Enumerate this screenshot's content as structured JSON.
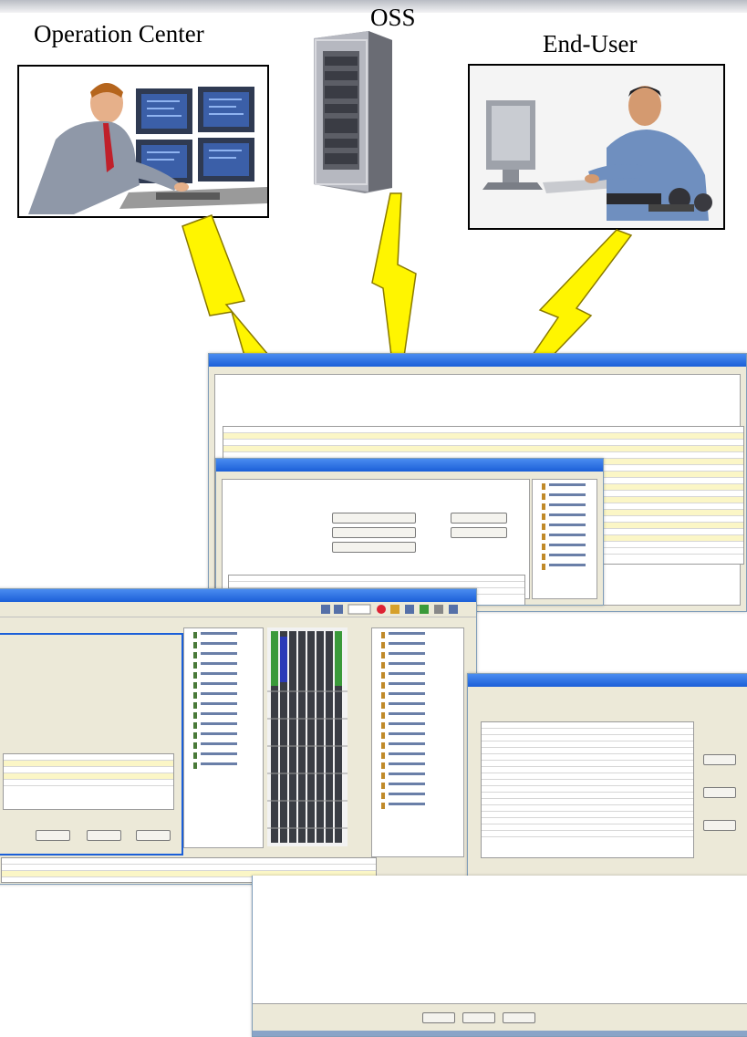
{
  "labels": {
    "operation_center": "Operation Center",
    "oss": "OSS",
    "end_user": "End-User"
  },
  "colors": {
    "lightning_fill": "#fff500",
    "lightning_stroke": "#8a7a00",
    "window_title": "#1b5fd8",
    "window_face": "#ece9d8",
    "row_highlight": "#fbf6c6"
  },
  "icons": [
    "lightning-bolt-icon",
    "server-rack-icon"
  ]
}
